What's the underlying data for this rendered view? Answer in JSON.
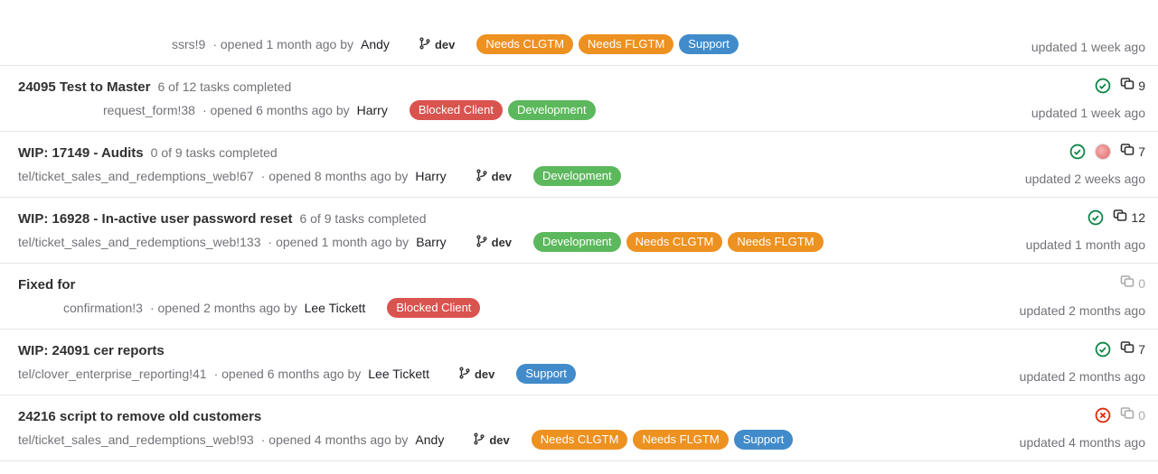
{
  "items": [
    {
      "title": "",
      "tasks": "",
      "ref": "ssrs!9",
      "opened": " · opened 1 month ago by ",
      "author": "Andy",
      "branch": "dev",
      "labels": [
        {
          "text": "Needs CLGTM",
          "color": "orange"
        },
        {
          "text": "Needs FLGTM",
          "color": "orange"
        },
        {
          "text": "Support",
          "color": "blue"
        }
      ],
      "status": "",
      "avatar": false,
      "comments": null,
      "updated": "updated 1 week ago",
      "line2_class": "first-item-line2"
    },
    {
      "title": "24095 Test to Master",
      "tasks": "6 of 12 tasks completed",
      "ref": "request_form!38",
      "opened": " · opened 6 months ago by ",
      "author": "Harry",
      "branch": "",
      "labels": [
        {
          "text": "Blocked Client",
          "color": "red"
        },
        {
          "text": "Development",
          "color": "green"
        }
      ],
      "status": "pass",
      "avatar": false,
      "comments": "9",
      "updated": "updated 1 week ago",
      "line2_class": "second-item-line2"
    },
    {
      "title": "WIP: 17149 - Audits",
      "tasks": "0 of 9 tasks completed",
      "ref": "tel/ticket_sales_and_redemptions_web!67",
      "opened": " · opened 8 months ago by ",
      "author": "Harry",
      "branch": "dev",
      "labels": [
        {
          "text": "Development",
          "color": "green"
        }
      ],
      "status": "pass",
      "avatar": true,
      "comments": "7",
      "updated": "updated 2 weeks ago",
      "line2_class": ""
    },
    {
      "title": "WIP: 16928 - In-active user password reset",
      "tasks": "6 of 9 tasks completed",
      "ref": "tel/ticket_sales_and_redemptions_web!133",
      "opened": " · opened 1 month ago by ",
      "author": "Barry",
      "branch": "dev",
      "labels": [
        {
          "text": "Development",
          "color": "green"
        },
        {
          "text": "Needs CLGTM",
          "color": "orange"
        },
        {
          "text": "Needs FLGTM",
          "color": "orange"
        }
      ],
      "status": "pass",
      "avatar": false,
      "comments": "12",
      "updated": "updated 1 month ago",
      "line2_class": ""
    },
    {
      "title": "Fixed for",
      "tasks": "",
      "ref": "confirmation!3",
      "opened": " · opened 2 months ago by ",
      "author": "Lee Tickett",
      "branch": "",
      "labels": [
        {
          "text": "Blocked Client",
          "color": "red"
        }
      ],
      "status": "",
      "avatar": false,
      "comments": "0",
      "updated": "updated 2 months ago",
      "line2_class": "fifth-item-line2"
    },
    {
      "title": "WIP: 24091 cer reports",
      "tasks": "",
      "ref": "tel/clover_enterprise_reporting!41",
      "opened": " · opened 6 months ago by ",
      "author": "Lee Tickett",
      "branch": "dev",
      "labels": [
        {
          "text": "Support",
          "color": "blue"
        }
      ],
      "status": "pass",
      "avatar": false,
      "comments": "7",
      "updated": "updated 2 months ago",
      "line2_class": ""
    },
    {
      "title": "24216 script to remove old customers",
      "tasks": "",
      "ref": "tel/ticket_sales_and_redemptions_web!93",
      "opened": " · opened 4 months ago by ",
      "author": "Andy",
      "branch": "dev",
      "labels": [
        {
          "text": "Needs CLGTM",
          "color": "orange"
        },
        {
          "text": "Needs FLGTM",
          "color": "orange"
        },
        {
          "text": "Support",
          "color": "blue"
        }
      ],
      "status": "fail",
      "avatar": false,
      "comments": "0",
      "updated": "updated 4 months ago",
      "line2_class": ""
    }
  ]
}
